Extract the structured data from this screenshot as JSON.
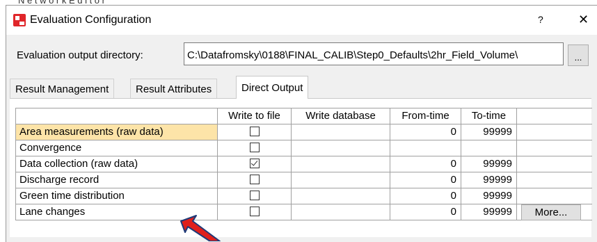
{
  "window": {
    "title": "Evaluation Configuration",
    "help_label": "?",
    "close_label": "✕"
  },
  "output": {
    "label": "Evaluation output directory:",
    "path": "C:\\Datafromsky\\0188\\FINAL_CALIB\\Step0_Defaults\\2hr_Field_Volume\\",
    "browse_label": "..."
  },
  "tabs": [
    {
      "label": "Result Management",
      "active": false
    },
    {
      "label": "Result Attributes",
      "active": false
    },
    {
      "label": "Direct Output",
      "active": true
    }
  ],
  "table": {
    "columns": [
      "",
      "Write to file",
      "Write database",
      "From-time",
      "To-time",
      ""
    ],
    "rows": [
      {
        "name": "Area measurements (raw data)",
        "write_to_file": false,
        "from": "0",
        "to": "99999",
        "selected": true
      },
      {
        "name": "Convergence",
        "write_to_file": false,
        "from": "",
        "to": ""
      },
      {
        "name": "Data collection (raw data)",
        "write_to_file": true,
        "from": "0",
        "to": "99999"
      },
      {
        "name": "Discharge record",
        "write_to_file": false,
        "from": "0",
        "to": "99999"
      },
      {
        "name": "Green time distribution",
        "write_to_file": false,
        "from": "0",
        "to": "99999"
      },
      {
        "name": "Lane changes",
        "write_to_file": false,
        "from": "0",
        "to": "99999",
        "more_label": "More..."
      }
    ]
  },
  "colors": {
    "selected_cell": "#fde4a8",
    "arrow": "#e0201b",
    "arrow_outline": "#1f3a78",
    "app_icon": "#e0262a"
  },
  "icons": {
    "app": "app-logo-icon",
    "arrow": "red-arrow-annotation"
  }
}
